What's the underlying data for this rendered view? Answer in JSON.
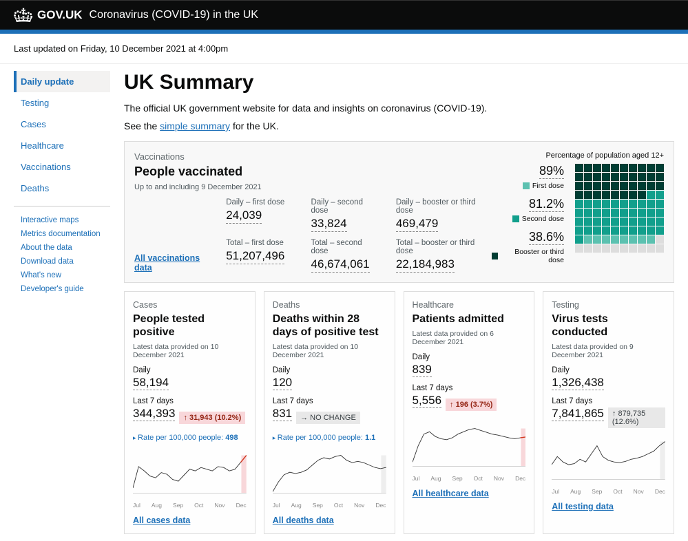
{
  "header": {
    "govuk": "GOV.UK",
    "title": "Coronavirus (COVID-19) in the UK"
  },
  "updated": "Last updated on Friday, 10 December 2021 at 4:00pm",
  "nav": {
    "items": [
      "Daily update",
      "Testing",
      "Cases",
      "Healthcare",
      "Vaccinations",
      "Deaths"
    ],
    "links": [
      "Interactive maps",
      "Metrics documentation",
      "About the data",
      "Download data",
      "What's new",
      "Developer's guide"
    ]
  },
  "page": {
    "title": "UK Summary",
    "intro": "The official UK government website for data and insights on coronavirus (COVID-19).",
    "see_prefix": "See the ",
    "see_link": "simple summary",
    "see_suffix": " for the UK."
  },
  "vacc": {
    "label": "Vaccinations",
    "heading": "People vaccinated",
    "date": "Up to and including 9 December 2021",
    "daily": [
      {
        "label": "Daily – first dose",
        "value": "24,039"
      },
      {
        "label": "Daily – second dose",
        "value": "33,824"
      },
      {
        "label": "Daily – booster or third dose",
        "value": "469,479"
      }
    ],
    "total": [
      {
        "label": "Total – first dose",
        "value": "51,207,496"
      },
      {
        "label": "Total – second dose",
        "value": "46,674,061"
      },
      {
        "label": "Total – booster or third dose",
        "value": "22,184,983"
      }
    ],
    "all_link": "All vaccinations data",
    "pct_title": "Percentage of population aged 12+",
    "pct": [
      {
        "value": "89%",
        "label": "First dose",
        "color": "#5cc1b0"
      },
      {
        "value": "81.2%",
        "label": "Second dose",
        "color": "#119f8c"
      },
      {
        "value": "38.6%",
        "label": "Booster or third dose",
        "color": "#003d33"
      }
    ]
  },
  "cards": [
    {
      "label": "Cases",
      "heading": "People tested positive",
      "date": "Latest data provided on 10 December 2021",
      "daily": "58,194",
      "last7": "344,393",
      "change_badge": "↑ 31,943 (10.2%)",
      "badge_class": "badge-red",
      "rate_prefix": "Rate per 100,000 people: ",
      "rate": "498",
      "all_link": "All cases data"
    },
    {
      "label": "Deaths",
      "heading": "Deaths within 28 days of positive test",
      "date": "Latest data provided on 10 December 2021",
      "daily": "120",
      "last7": "831",
      "change_badge": "→ NO CHANGE",
      "badge_class": "badge-grey",
      "rate_prefix": "Rate per 100,000 people: ",
      "rate": "1.1",
      "all_link": "All deaths data"
    },
    {
      "label": "Healthcare",
      "heading": "Patients admitted",
      "date": "Latest data provided on 6 December 2021",
      "daily": "839",
      "last7": "5,556",
      "change_badge": "↑ 196 (3.7%)",
      "badge_class": "badge-red",
      "all_link": "All healthcare data"
    },
    {
      "label": "Testing",
      "heading": "Virus tests conducted",
      "date": "Latest data provided on 9 December 2021",
      "daily": "1,326,438",
      "last7": "7,841,865",
      "change_badge": "↑ 879,735 (12.6%)",
      "badge_class": "badge-grey",
      "all_link": "All testing data"
    }
  ],
  "labels": {
    "daily": "Daily",
    "last7": "Last 7 days"
  },
  "months": [
    "Jul",
    "Aug",
    "Sep",
    "Oct",
    "Nov",
    "Dec"
  ],
  "chart_data": [
    {
      "name": "cases",
      "type": "line",
      "x_months": [
        "Jul",
        "Aug",
        "Sep",
        "Oct",
        "Nov",
        "Dec"
      ],
      "values": [
        20000,
        45000,
        40000,
        34000,
        32000,
        38000,
        36000,
        30000,
        28000,
        35000,
        42000,
        40000,
        44000,
        42000,
        40000,
        45000,
        44000,
        40000,
        42000,
        50000,
        58194
      ],
      "highlight_last": true
    },
    {
      "name": "deaths",
      "type": "line",
      "x_months": [
        "Jul",
        "Aug",
        "Sep",
        "Oct",
        "Nov",
        "Dec"
      ],
      "values": [
        20,
        60,
        90,
        100,
        95,
        100,
        110,
        130,
        150,
        160,
        155,
        165,
        170,
        150,
        140,
        145,
        140,
        130,
        120,
        115,
        120
      ],
      "highlight_last": true
    },
    {
      "name": "healthcare",
      "type": "line",
      "x_months": [
        "Jul",
        "Aug",
        "Sep",
        "Oct",
        "Nov",
        "Dec"
      ],
      "values": [
        300,
        650,
        900,
        950,
        850,
        800,
        780,
        820,
        900,
        950,
        1000,
        1020,
        980,
        940,
        900,
        880,
        850,
        820,
        800,
        820,
        839
      ],
      "highlight_last": true
    },
    {
      "name": "testing",
      "type": "line",
      "x_months": [
        "Jul",
        "Aug",
        "Sep",
        "Oct",
        "Nov",
        "Dec"
      ],
      "values": [
        900000,
        1050000,
        950000,
        900000,
        920000,
        1000000,
        950000,
        1100000,
        1250000,
        1050000,
        980000,
        950000,
        940000,
        960000,
        1000000,
        1020000,
        1050000,
        1100000,
        1150000,
        1250000,
        1326438
      ],
      "highlight_last": true
    }
  ]
}
